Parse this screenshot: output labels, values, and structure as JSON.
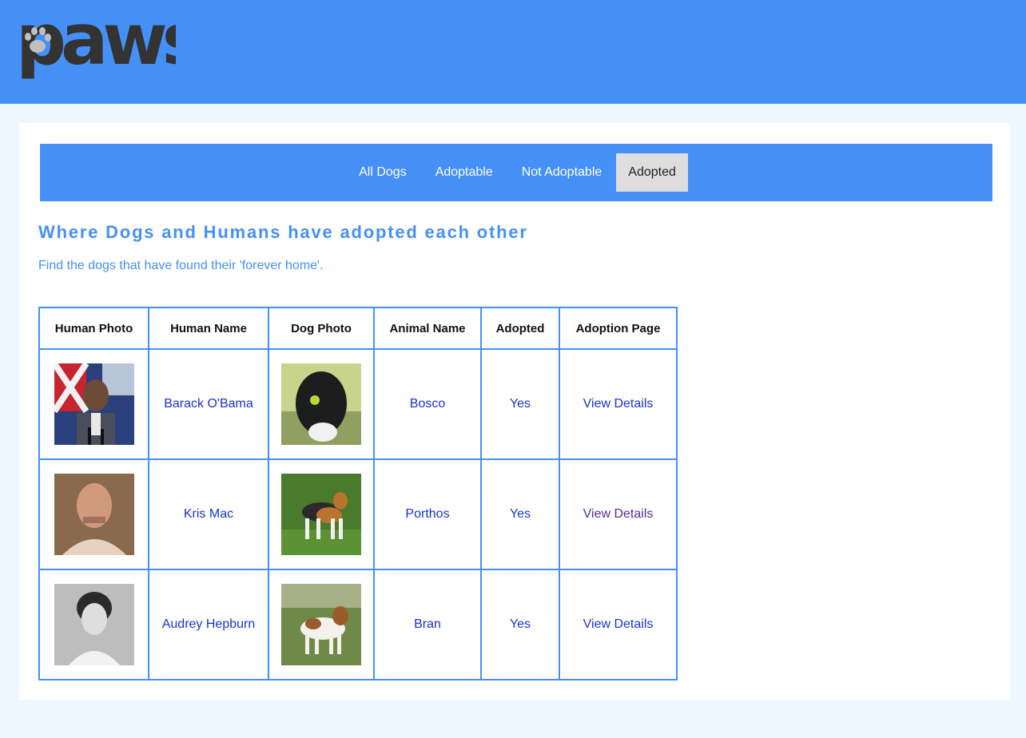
{
  "brand": {
    "logo_text": "paws"
  },
  "nav": {
    "items": [
      {
        "label": "All Dogs",
        "active": false
      },
      {
        "label": "Adoptable",
        "active": false
      },
      {
        "label": "Not Adoptable",
        "active": false
      },
      {
        "label": "Adopted",
        "active": true
      }
    ]
  },
  "main": {
    "heading": "Where Dogs and Humans have adopted each other",
    "subheading": "Find the dogs that have found their 'forever home'."
  },
  "table": {
    "headers": [
      "Human Photo",
      "Human Name",
      "Dog Photo",
      "Animal Name",
      "Adopted",
      "Adoption Page"
    ],
    "rows": [
      {
        "human_name": "Barack O'Bama",
        "animal_name": "Bosco",
        "adopted": "Yes",
        "link": "View Details"
      },
      {
        "human_name": "Kris Mac",
        "animal_name": "Porthos",
        "adopted": "Yes",
        "link": "View Details"
      },
      {
        "human_name": "Audrey Hepburn",
        "animal_name": "Bran",
        "adopted": "Yes",
        "link": "View Details"
      }
    ]
  },
  "colors": {
    "accent": "#4590f7",
    "link": "#1a33cc",
    "visited_link": "#5a2a8a",
    "page_bg": "#eef6ff"
  }
}
